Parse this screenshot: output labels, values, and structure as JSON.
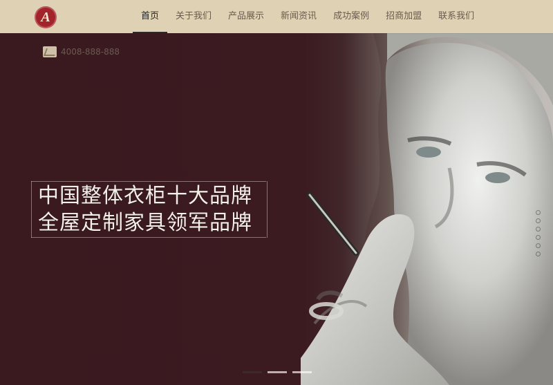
{
  "brand": {
    "logo_letter": "A",
    "accent_color": "#a3232a",
    "topbar_color": "#dfd1b4"
  },
  "nav": {
    "items": [
      {
        "label": "首页",
        "active": true
      },
      {
        "label": "关于我们",
        "active": false
      },
      {
        "label": "产品展示",
        "active": false
      },
      {
        "label": "新闻资讯",
        "active": false
      },
      {
        "label": "成功案例",
        "active": false
      },
      {
        "label": "招商加盟",
        "active": false
      },
      {
        "label": "联系我们",
        "active": false
      }
    ]
  },
  "contact": {
    "phone": "4008-888-888",
    "icon": "phone-icon"
  },
  "hero": {
    "headline_line1": "中国整体衣柜十大品牌",
    "headline_line2": "全屋定制家具领军品牌",
    "image": "man-with-pen-portrait",
    "side_dots": [
      {
        "active": false
      },
      {
        "active": false
      },
      {
        "active": false
      },
      {
        "active": false
      },
      {
        "active": false
      },
      {
        "active": false
      }
    ],
    "slides": [
      {
        "active": true
      },
      {
        "active": false
      },
      {
        "active": false
      }
    ]
  }
}
